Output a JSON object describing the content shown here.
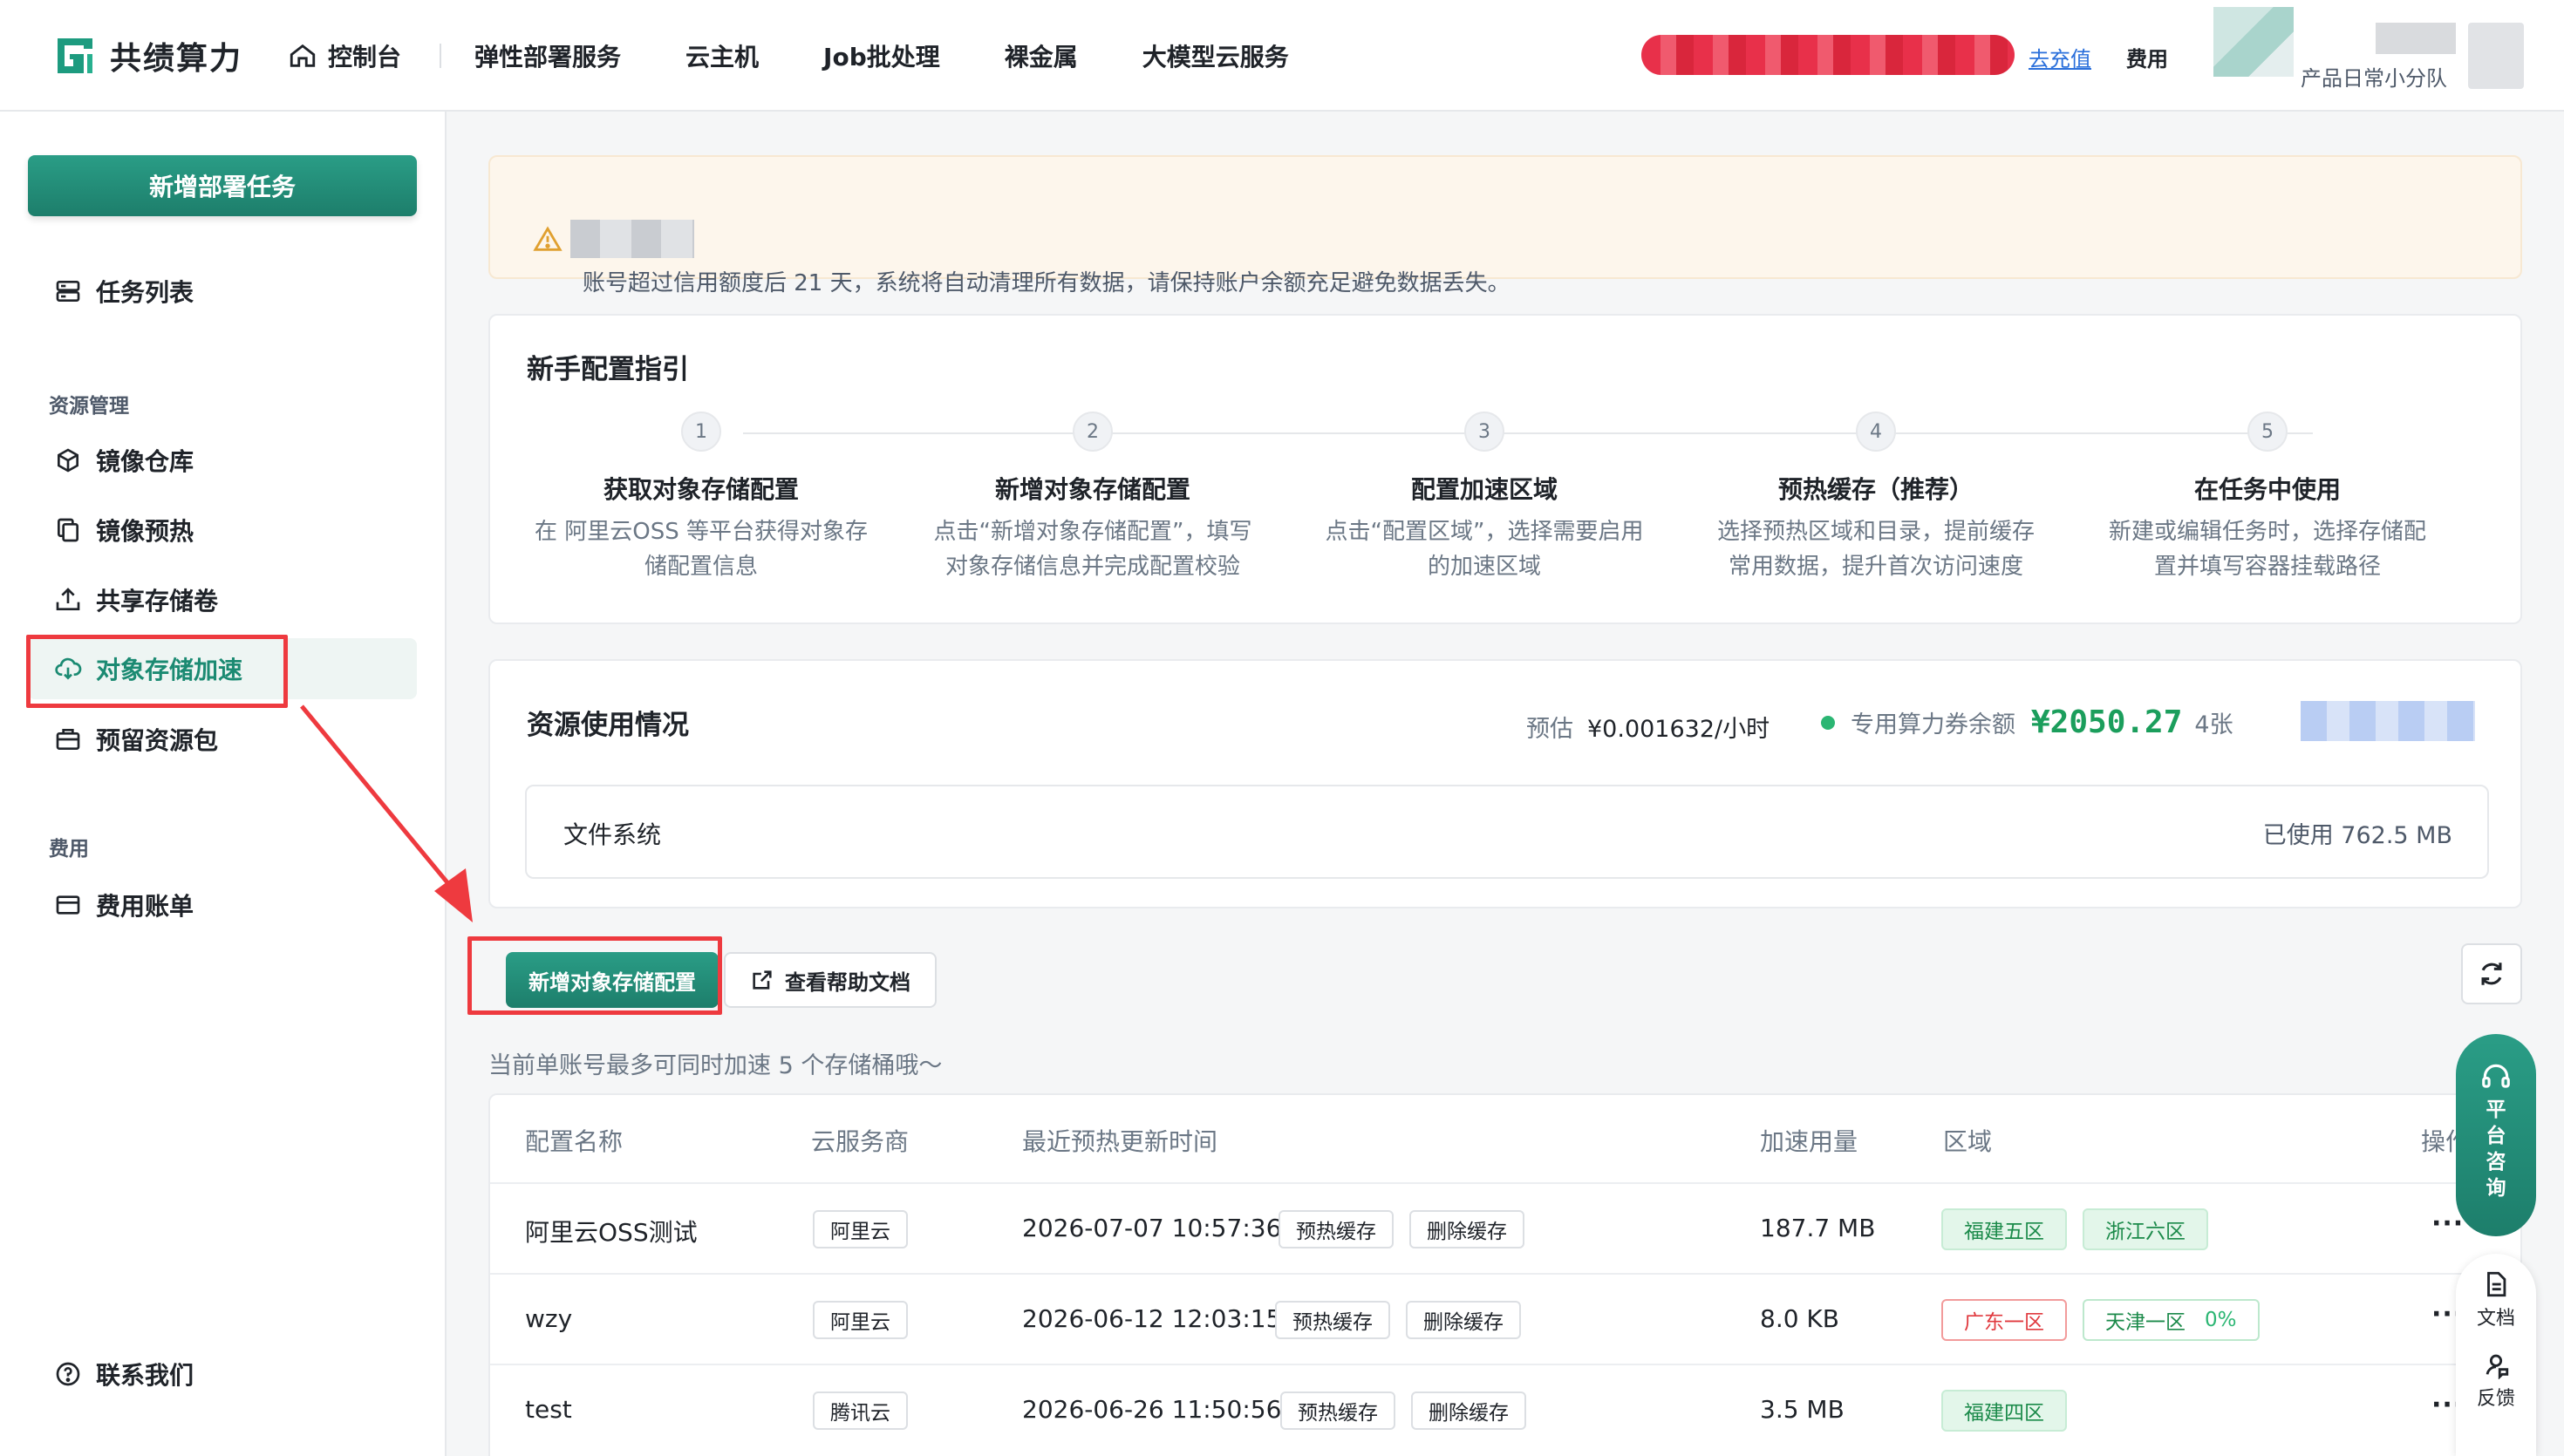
{
  "header": {
    "brand": "共绩算力",
    "nav": [
      "控制台",
      "弹性部署服务",
      "云主机",
      "Job批处理",
      "裸金属",
      "大模型云服务"
    ],
    "recharge": "去充值",
    "fee": "费用",
    "team": "产品日常小分队"
  },
  "sidebar": {
    "new_task": "新增部署任务",
    "task_list": "任务列表",
    "section_resource": "资源管理",
    "items": [
      "镜像仓库",
      "镜像预热",
      "共享存储卷",
      "对象存储加速",
      "预留资源包"
    ],
    "section_fee": "费用",
    "fee_bill": "费用账单",
    "contact": "联系我们"
  },
  "alert": {
    "text": "账号超过信用额度后 21 天，系统将自动清理所有数据，请保持账户余额充足避免数据丢失。"
  },
  "guide": {
    "title": "新手配置指引",
    "steps": [
      {
        "num": "1",
        "title": "获取对象存储配置",
        "desc1": "在 阿里云OSS 等平台获得对象存",
        "desc2": "储配置信息"
      },
      {
        "num": "2",
        "title": "新增对象存储配置",
        "desc1": "点击“新增对象存储配置”，填写",
        "desc2": "对象存储信息并完成配置校验"
      },
      {
        "num": "3",
        "title": "配置加速区域",
        "desc1": "点击“配置区域”，选择需要启用",
        "desc2": "的加速区域"
      },
      {
        "num": "4",
        "title": "预热缓存（推荐）",
        "desc1": "选择预热区域和目录，提前缓存",
        "desc2": "常用数据，提升首次访问速度"
      },
      {
        "num": "5",
        "title": "在任务中使用",
        "desc1": "新建或编辑任务时，选择存储配",
        "desc2": "置并填写容器挂载路径"
      }
    ]
  },
  "usage": {
    "title": "资源使用情况",
    "estimate_label": "预估",
    "estimate_value": "¥0.001632/小时",
    "coupon_label": "专用算力券余额",
    "coupon_amount": "¥2050.27",
    "coupon_count": "4张",
    "fs_label": "文件系统",
    "fs_used": "已使用 762.5 MB"
  },
  "actions": {
    "add_config": "新增对象存储配置",
    "help_doc": "查看帮助文档",
    "hint": "当前单账号最多可同时加速 5 个存储桶哦～"
  },
  "table": {
    "headers": [
      "配置名称",
      "云服务商",
      "最近预热更新时间",
      "加速用量",
      "区域",
      "操作"
    ],
    "prewarm_label": "预热缓存",
    "delete_label": "删除缓存",
    "more": "···",
    "rows": [
      {
        "name": "阿里云OSS测试",
        "provider": "阿里云",
        "time": "2026-07-07 10:57:36",
        "usage": "187.7 MB",
        "region1": "福建五区",
        "region2": "浙江六区"
      },
      {
        "name": "wzy",
        "provider": "阿里云",
        "time": "2026-06-12 12:03:15",
        "usage": "8.0 KB",
        "region1": "广东一区",
        "region2": "天津一区",
        "region2_pct": "0%"
      },
      {
        "name": "test",
        "provider": "腾讯云",
        "time": "2026-06-26 11:50:56",
        "usage": "3.5 MB",
        "region1": "福建四区"
      }
    ]
  },
  "floating": {
    "consult": "平台咨询",
    "doc": "文档",
    "feedback": "反馈"
  },
  "colors": {
    "brand": "#1d7e6b",
    "highlight": "#ee3a3f",
    "coupon": "#1b9e5c"
  }
}
